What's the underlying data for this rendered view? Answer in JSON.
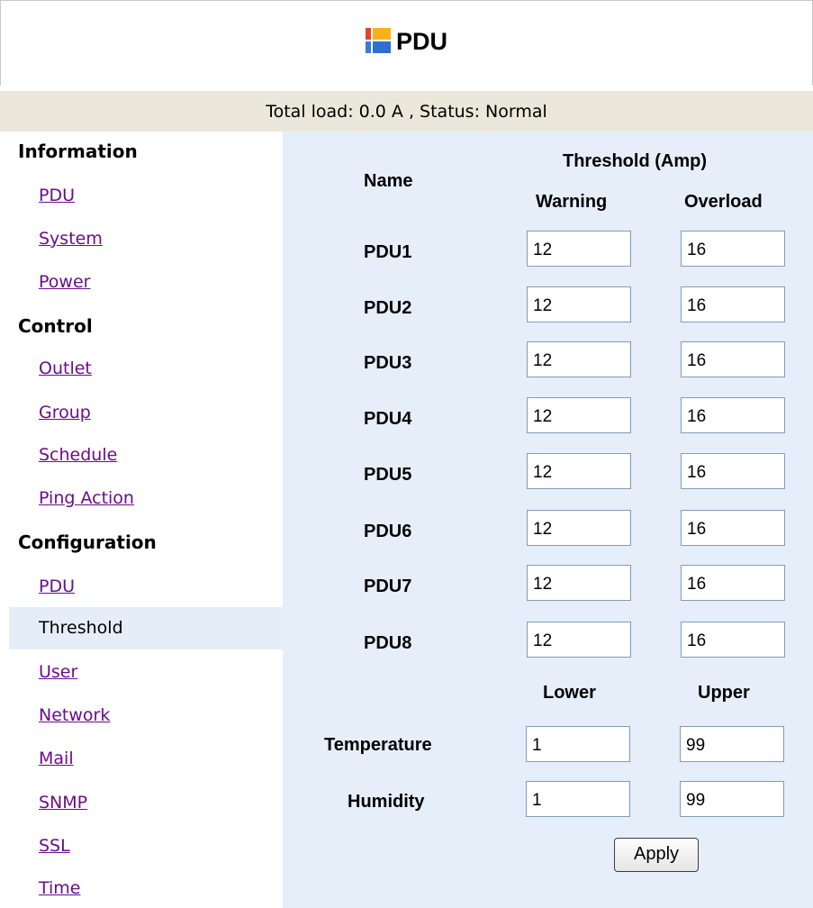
{
  "header": {
    "title": "PDU",
    "logo_icon": "windows-tile-logo"
  },
  "status": {
    "text": "Total load: 0.0 A , Status: Normal"
  },
  "sidebar": {
    "sections": [
      {
        "label": "Information",
        "items": [
          "PDU",
          "System",
          "Power"
        ]
      },
      {
        "label": "Control",
        "items": [
          "Outlet",
          "Group",
          "Schedule",
          "Ping Action"
        ]
      },
      {
        "label": "Configuration",
        "items": [
          "PDU",
          "Threshold",
          "User",
          "Network",
          "Mail",
          "SNMP",
          "SSL",
          "Time"
        ]
      }
    ],
    "active_item": "Threshold",
    "link_color": "#6a0d8a",
    "active_bg": "#e5edf8"
  },
  "form": {
    "name_header": "Name",
    "threshold_header": "Threshold (Amp)",
    "warning_header": "Warning",
    "overload_header": "Overload",
    "pdus": [
      {
        "name": "PDU1",
        "warning": "12",
        "overload": "16"
      },
      {
        "name": "PDU2",
        "warning": "12",
        "overload": "16"
      },
      {
        "name": "PDU3",
        "warning": "12",
        "overload": "16"
      },
      {
        "name": "PDU4",
        "warning": "12",
        "overload": "16"
      },
      {
        "name": "PDU5",
        "warning": "12",
        "overload": "16"
      },
      {
        "name": "PDU6",
        "warning": "12",
        "overload": "16"
      },
      {
        "name": "PDU7",
        "warning": "12",
        "overload": "16"
      },
      {
        "name": "PDU8",
        "warning": "12",
        "overload": "16"
      }
    ],
    "lower_header": "Lower",
    "upper_header": "Upper",
    "sensors": [
      {
        "name": "Temperature",
        "lower": "1",
        "upper": "99"
      },
      {
        "name": "Humidity",
        "lower": "1",
        "upper": "99"
      }
    ],
    "apply_label": "Apply"
  },
  "colors": {
    "panel_bg": "#e6eefa",
    "status_bg": "#ebe7da"
  }
}
